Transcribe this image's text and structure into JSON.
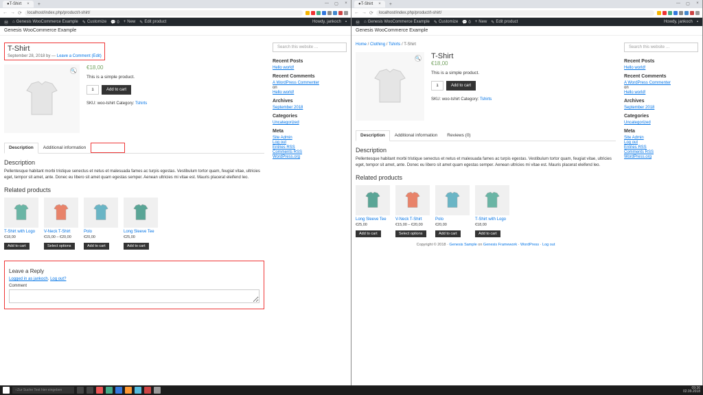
{
  "browser": {
    "tab_title": "T-Shirt",
    "url": "localhost/index.php/product/t-shirt/",
    "admin_bar": {
      "site_name": "Genesis WooCommerce Example",
      "customize": "Customize",
      "new": "New",
      "edit": "Edit product",
      "howdy": "Howdy, jankoch"
    },
    "site_title": "Genesis WooCommerce Example"
  },
  "product": {
    "title": "T-Shirt",
    "meta_date": "September 28, 2018",
    "meta_by": "by",
    "meta_leave_comment": "Leave a Comment",
    "meta_edit": "(Edit)",
    "price": "€18,00",
    "short_desc": "This is a simple product.",
    "qty": "1",
    "add_to_cart": "Add to cart",
    "sku_label": "SKU:",
    "sku": "woo-tshirt",
    "cat_label": "Category:",
    "category": "Tshirts"
  },
  "tabs": {
    "description": "Description",
    "additional": "Additional information",
    "reviews": "Reviews (0)"
  },
  "desc": {
    "heading": "Description",
    "text": "Pellentesque habitant morbi tristique senectus et netus et malesuada fames ac turpis egestas. Vestibulum tortor quam, feugiat vitae, ultricies eget, tempor sit amet, ante. Donec eu libero sit amet quam egestas semper. Aenean ultricies mi vitae est. Mauris placerat eleifend leo."
  },
  "related": {
    "heading": "Related products",
    "left": [
      {
        "title": "T-Shirt with Logo",
        "price": "€18,00",
        "btn": "Add to cart",
        "color": "#6ab5a5"
      },
      {
        "title": "V-Neck T-Shirt",
        "price": "€15,00 – €20,00",
        "btn": "Select options",
        "color": "#e8836a"
      },
      {
        "title": "Polo",
        "price": "€20,00",
        "btn": "Add to cart",
        "color": "#6ab5c5"
      },
      {
        "title": "Long Sleeve Tee",
        "price": "€25,00",
        "btn": "Add to cart",
        "color": "#5aa596"
      }
    ],
    "right": [
      {
        "title": "Long Sleeve Tee",
        "price": "€25,00",
        "btn": "Add to cart",
        "color": "#5aa596"
      },
      {
        "title": "V-Neck T-Shirt",
        "price": "€15,00 – €20,00",
        "btn": "Select options",
        "color": "#e8836a"
      },
      {
        "title": "Polo",
        "price": "€20,00",
        "btn": "Add to cart",
        "color": "#6ab5c5"
      },
      {
        "title": "T-Shirt with Logo",
        "price": "€18,00",
        "btn": "Add to cart",
        "color": "#6ab5a5"
      }
    ]
  },
  "sidebar": {
    "search_placeholder": "Search this website …",
    "recent_posts": "Recent Posts",
    "hello_world": "Hello world!",
    "recent_comments": "Recent Comments",
    "commenter": "A WordPress Commenter",
    "on": "on",
    "archives": "Archives",
    "sept": "September 2018",
    "categories": "Categories",
    "uncategorized": "Uncategorized",
    "meta": "Meta",
    "site_admin": "Site Admin",
    "logout": "Log out",
    "entries_rss": "Entries RSS",
    "comments_rss": "Comments RSS",
    "wporg": "WordPress.org"
  },
  "comments": {
    "heading": "Leave a Reply",
    "logged_in": "Logged in as jankoch",
    "logout": "Log out?",
    "comment_label": "Comment"
  },
  "breadcrumb": {
    "home": "Home",
    "clothing": "Clothing",
    "tshirts": "Tshirts",
    "current": "T-Shirt"
  },
  "footer": {
    "copyright": "Copyright © 2018 ·",
    "theme": "Genesis Sample",
    "on": "on",
    "framework": "Genesis Framework",
    "wp": "WordPress",
    "logout": "Log out"
  },
  "taskbar": {
    "search": "Zur Suche Text hier eingeben",
    "time": "09:36",
    "date": "02.09.2018"
  }
}
